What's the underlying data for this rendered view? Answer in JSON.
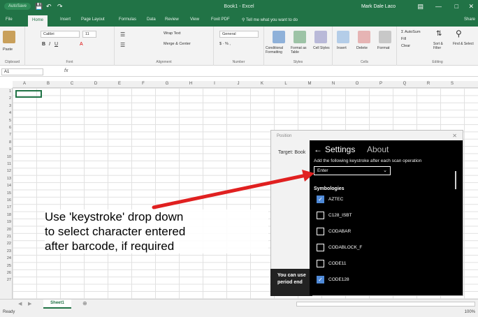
{
  "titlebar": {
    "autosave": "AutoSave",
    "title": "Book1 - Excel",
    "user": "Mark Dale Laco"
  },
  "tabs": [
    "File",
    "Home",
    "Insert",
    "Page Layout",
    "Formulas",
    "Data",
    "Review",
    "View",
    "Foxit PDF"
  ],
  "tellme": "Tell me what you want to do",
  "share": "Share",
  "ribbon": {
    "paste": "Paste",
    "font_name": "Calibri",
    "font_size": "11",
    "wrap_text": "Wrap Text",
    "merge_center": "Merge & Center",
    "number_format": "General",
    "conditional": "Conditional Formatting",
    "format_table": "Format as Table",
    "cell_styles": "Cell Styles",
    "insert": "Insert",
    "delete": "Delete",
    "format": "Format",
    "autosum": "AutoSum",
    "fill": "Fill",
    "clear": "Clear",
    "sort": "Sort & Filter",
    "find": "Find & Select",
    "groups": [
      "Clipboard",
      "Font",
      "Alignment",
      "Number",
      "Styles",
      "Cells",
      "Editing"
    ]
  },
  "formula": {
    "namebox": "A1",
    "fx": "fx"
  },
  "columns": [
    "A",
    "B",
    "C",
    "D",
    "E",
    "F",
    "G",
    "H",
    "I",
    "J",
    "K",
    "L",
    "M",
    "N",
    "O",
    "P",
    "Q",
    "R",
    "S"
  ],
  "rows": [
    "1",
    "2",
    "3",
    "4",
    "5",
    "6",
    "7",
    "8",
    "9",
    "10",
    "11",
    "12",
    "13",
    "14",
    "15",
    "16",
    "17",
    "18",
    "19",
    "20",
    "21",
    "22",
    "23",
    "24",
    "25",
    "26",
    "27"
  ],
  "sheet": {
    "tab": "Sheet1",
    "status": "Ready",
    "zoom": "100%"
  },
  "dialog": {
    "title": "Position",
    "target": "Target: Book",
    "note": "You can use period end"
  },
  "panel": {
    "settings": "Settings",
    "about": "About",
    "description": "Add the following keystroke after each scan operation",
    "keystroke": "Enter",
    "symbologies_heading": "Symbologies",
    "symbologies": [
      {
        "label": "AZTEC",
        "checked": true
      },
      {
        "label": "C128_ISBT",
        "checked": false
      },
      {
        "label": "CODABAR",
        "checked": false
      },
      {
        "label": "CODABLOCK_F",
        "checked": false
      },
      {
        "label": "CODE11",
        "checked": false
      },
      {
        "label": "CODE128",
        "checked": true
      }
    ]
  },
  "annotation": {
    "line1": "Use 'keystroke' drop down",
    "line2": "to select character entered",
    "line3": "after barcode, if required"
  },
  "colors": {
    "excel_green": "#217346",
    "arrow": "#e02020",
    "checkbox": "#4f8ad8"
  }
}
